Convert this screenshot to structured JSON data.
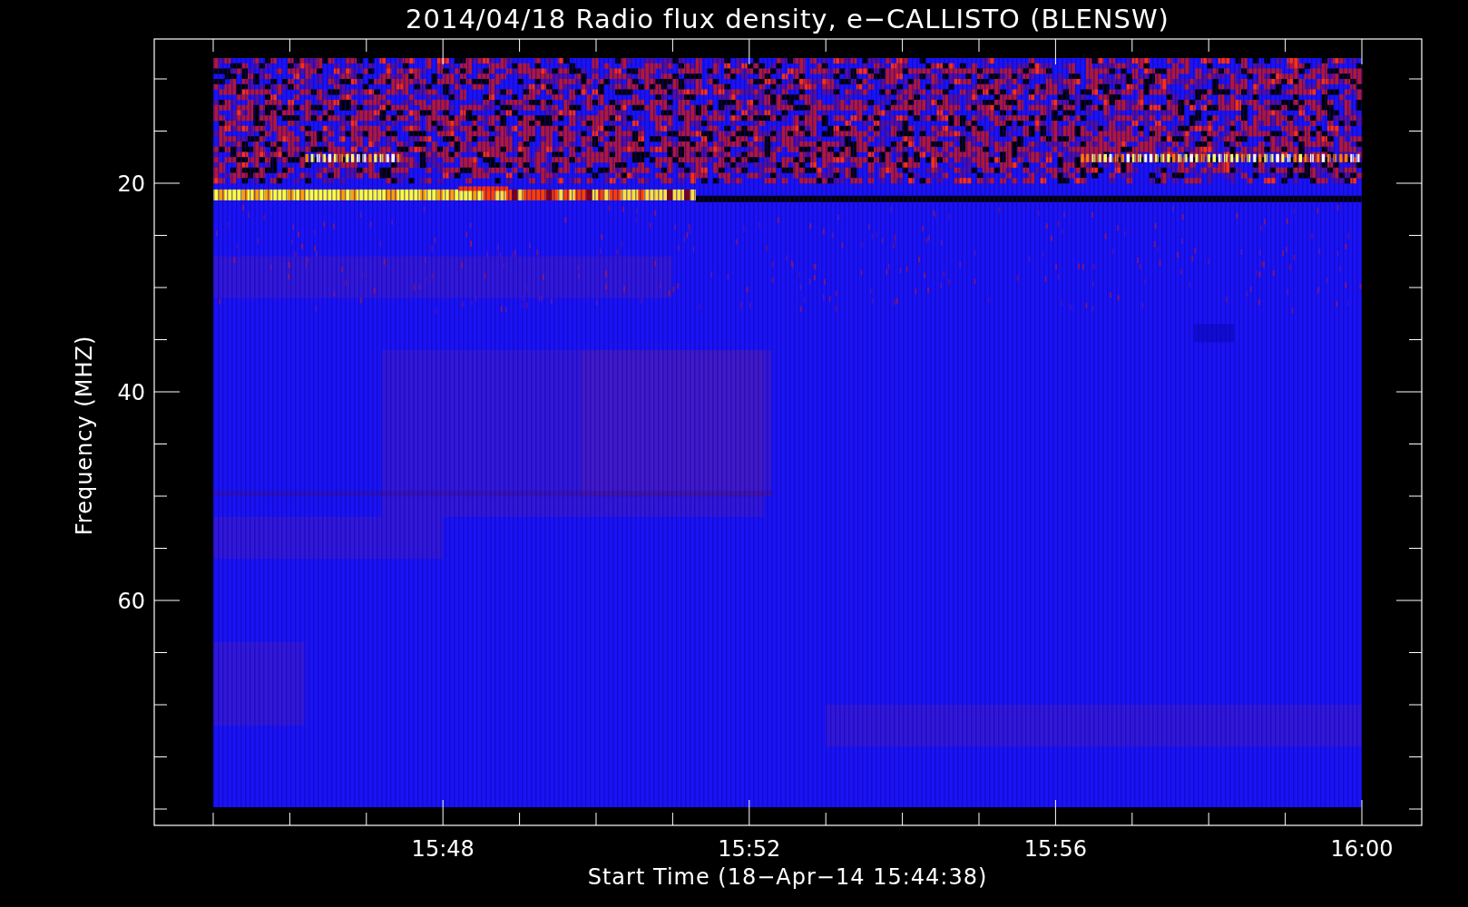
{
  "title": "2014/04/18  Radio flux density, e−CALLISTO (BLENSW)",
  "ylabel": "Frequency (MHZ)",
  "xlabel": "Start Time (18−Apr−14 15:44:38)",
  "yticks": [
    "20",
    "40",
    "60"
  ],
  "xticks": [
    "15:48",
    "15:52",
    "15:56",
    "16:00"
  ]
}
